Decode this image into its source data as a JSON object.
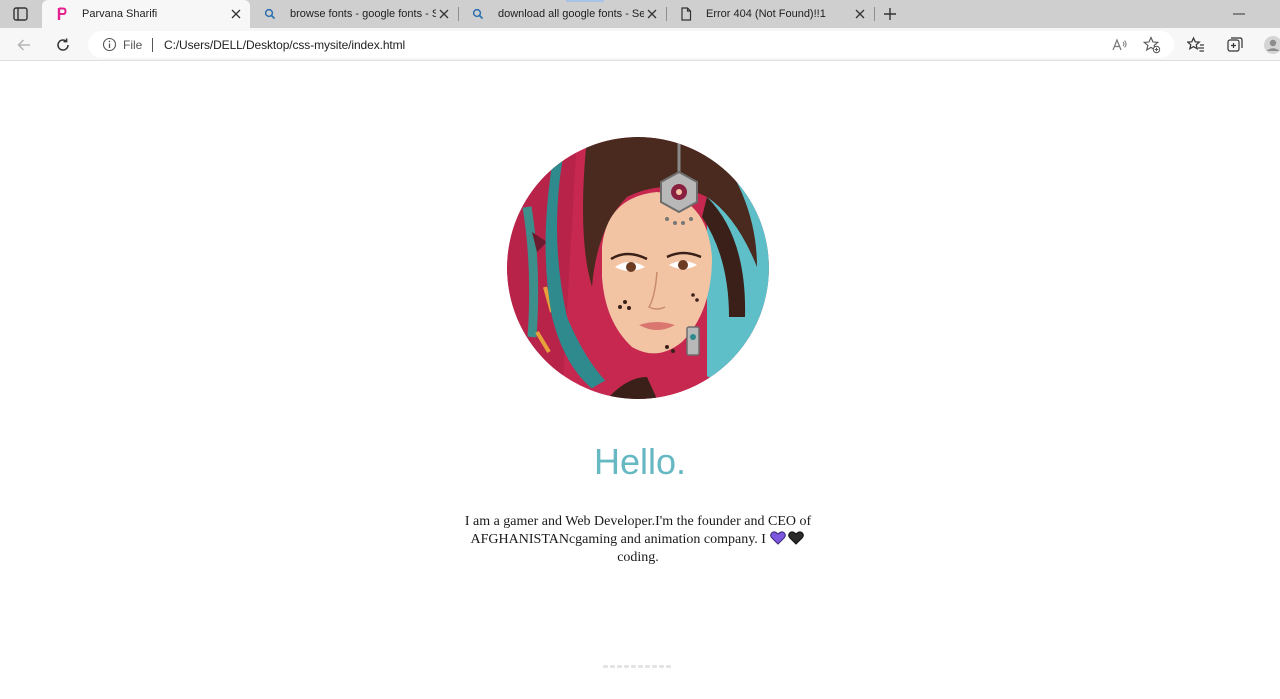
{
  "browser": {
    "tabs": [
      {
        "title": "Parvana Sharifi",
        "active": true,
        "favicon": "p-letter-icon"
      },
      {
        "title": "browse fonts - google fonts - Se",
        "active": false,
        "favicon": "search-icon"
      },
      {
        "title": "download all google fonts - Sear",
        "active": false,
        "favicon": "search-icon"
      },
      {
        "title": "Error 404 (Not Found)!!1",
        "active": false,
        "favicon": "document-icon"
      }
    ],
    "address": {
      "scheme_label": "File",
      "url": "C:/Users/DELL/Desktop/css-mysite/index.html"
    }
  },
  "page": {
    "greeting": "Hello.",
    "intro_text_part1": "I am a gamer and Web Developer.I'm the founder and CEO of AFGHANISTANcgaming and animation company. I",
    "intro_text_part2": "coding.",
    "profile_image_alt": "profile illustration"
  },
  "colors": {
    "accent": "#66b8c2",
    "heart_purple": "#7e57e0",
    "heart_black": "#2b2b2b",
    "tab_strip": "#cfcfcf",
    "tab_active": "#f7f7f7"
  }
}
